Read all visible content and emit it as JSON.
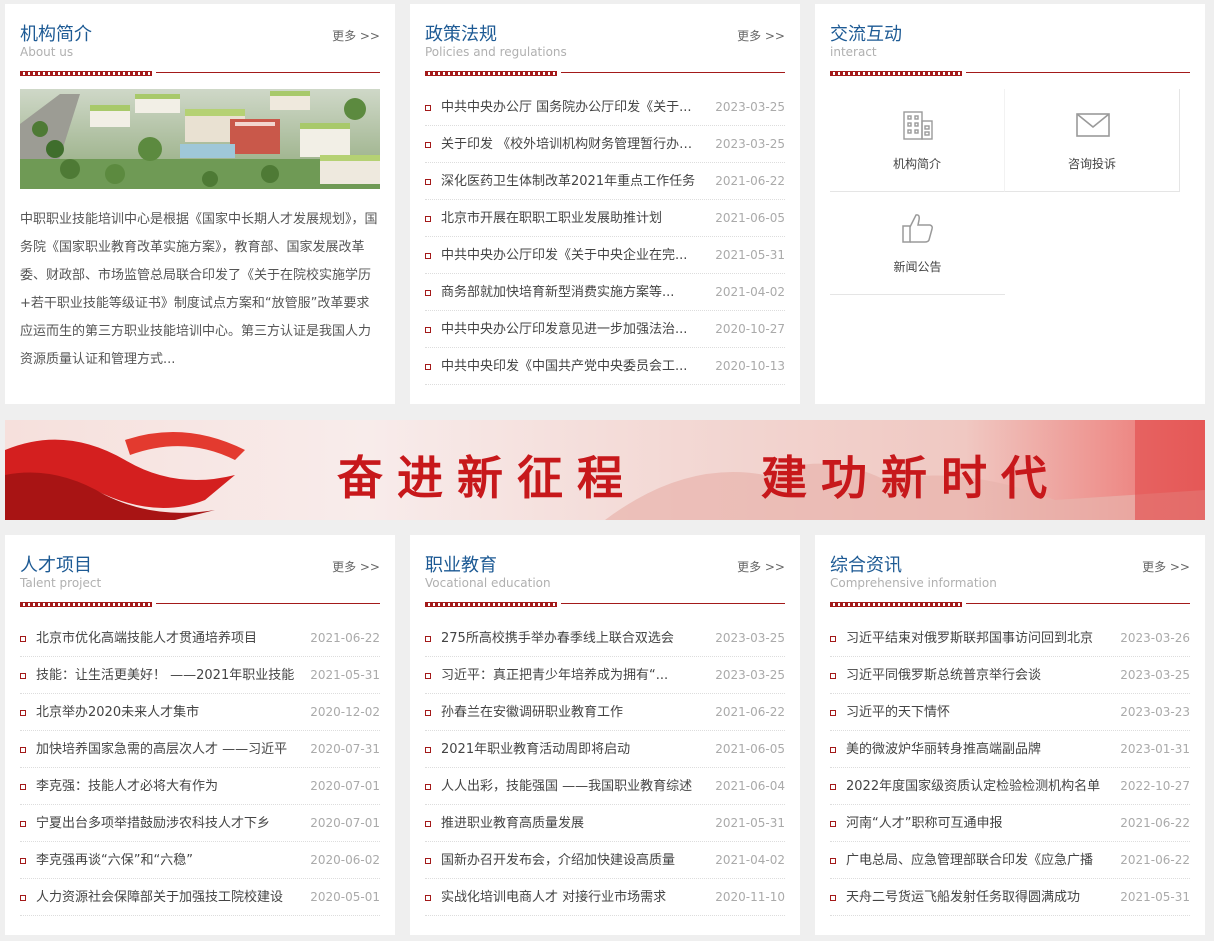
{
  "panels": {
    "about": {
      "title": "机构简介",
      "subtitle": "About us",
      "more": "更多 >>",
      "intro": "中职职业技能培训中心是根据《国家中长期人才发展规划》，国务院《国家职业教育改革实施方案》，教育部、国家发展改革委、财政部、市场监管总局联合印发了《关于在院校实施学历+若干职业技能等级证书》制度试点方案和“放管服”改革要求应运而生的第三方职业技能培训中心。第三方认证是我国人力资源质量认证和管理方式..."
    },
    "policy": {
      "title": "政策法规",
      "subtitle": "Policies and regulations",
      "more": "更多 >>",
      "items": [
        {
          "title": "中共中央办公厅 国务院办公厅印发《关于...",
          "date": "2023-03-25"
        },
        {
          "title": "关于印发 《校外培训机构财务管理暂行办法》",
          "date": "2023-03-25"
        },
        {
          "title": "深化医药卫生体制改革2021年重点工作任务",
          "date": "2021-06-22"
        },
        {
          "title": "北京市开展在职职工职业发展助推计划",
          "date": "2021-06-05"
        },
        {
          "title": "中共中央办公厅印发《关于中央企业在完...",
          "date": "2021-05-31"
        },
        {
          "title": "商务部就加快培育新型消费实施方案等...",
          "date": "2021-04-02"
        },
        {
          "title": "中共中央办公厅印发意见进一步加强法治...",
          "date": "2020-10-27"
        },
        {
          "title": "中共中央印发《中国共产党中央委员会工...",
          "date": "2020-10-13"
        }
      ]
    },
    "interact": {
      "title": "交流互动",
      "subtitle": "interact",
      "cells": [
        {
          "label": "机构简介",
          "icon": "building-icon"
        },
        {
          "label": "咨询投诉",
          "icon": "mail-icon"
        },
        {
          "label": "新闻公告",
          "icon": "thumbs-up-icon"
        }
      ]
    },
    "talent": {
      "title": "人才项目",
      "subtitle": "Talent project",
      "more": "更多 >>",
      "items": [
        {
          "title": "北京市优化高端技能人才贯通培养项目",
          "date": "2021-06-22"
        },
        {
          "title": "技能：让生活更美好！ ——2021年职业技能",
          "date": "2021-05-31"
        },
        {
          "title": "北京举办2020未来人才集市",
          "date": "2020-12-02"
        },
        {
          "title": "加快培养国家急需的高层次人才 ——习近平",
          "date": "2020-07-31"
        },
        {
          "title": "李克强：技能人才必将大有作为",
          "date": "2020-07-01"
        },
        {
          "title": "宁夏出台多项举措鼓励涉农科技人才下乡",
          "date": "2020-07-01"
        },
        {
          "title": "李克强再谈“六保”和“六稳”",
          "date": "2020-06-02"
        },
        {
          "title": "人力资源社会保障部关于加强技工院校建设",
          "date": "2020-05-01"
        }
      ]
    },
    "vocational": {
      "title": "职业教育",
      "subtitle": "Vocational education",
      "more": "更多 >>",
      "items": [
        {
          "title": "275所高校携手举办春季线上联合双选会",
          "date": "2023-03-25"
        },
        {
          "title": "习近平：真正把青少年培养成为拥有“...",
          "date": "2023-03-25"
        },
        {
          "title": "孙春兰在安徽调研职业教育工作",
          "date": "2021-06-22"
        },
        {
          "title": "2021年职业教育活动周即将启动",
          "date": "2021-06-05"
        },
        {
          "title": "人人出彩，技能强国 ——我国职业教育综述",
          "date": "2021-06-04"
        },
        {
          "title": "推进职业教育高质量发展",
          "date": "2021-05-31"
        },
        {
          "title": "国新办召开发布会，介绍加快建设高质量",
          "date": "2021-04-02"
        },
        {
          "title": "实战化培训电商人才 对接行业市场需求",
          "date": "2020-11-10"
        }
      ]
    },
    "news": {
      "title": "综合资讯",
      "subtitle": "Comprehensive information",
      "more": "更多 >>",
      "items": [
        {
          "title": "习近平结束对俄罗斯联邦国事访问回到北京",
          "date": "2023-03-26"
        },
        {
          "title": "习近平同俄罗斯总统普京举行会谈",
          "date": "2023-03-25"
        },
        {
          "title": "习近平的天下情怀",
          "date": "2023-03-23"
        },
        {
          "title": "美的微波炉华丽转身推高端副品牌",
          "date": "2023-01-31"
        },
        {
          "title": "2022年度国家级资质认定检验检测机构名单",
          "date": "2022-10-27"
        },
        {
          "title": "河南“人才”职称可互通申报",
          "date": "2021-06-22"
        },
        {
          "title": "广电总局、应急管理部联合印发《应急广播",
          "date": "2021-06-22"
        },
        {
          "title": "天舟二号货运飞船发射任务取得圆满成功",
          "date": "2021-05-31"
        }
      ]
    }
  },
  "banner": {
    "left": "奋进新征程",
    "right": "建功新时代"
  }
}
